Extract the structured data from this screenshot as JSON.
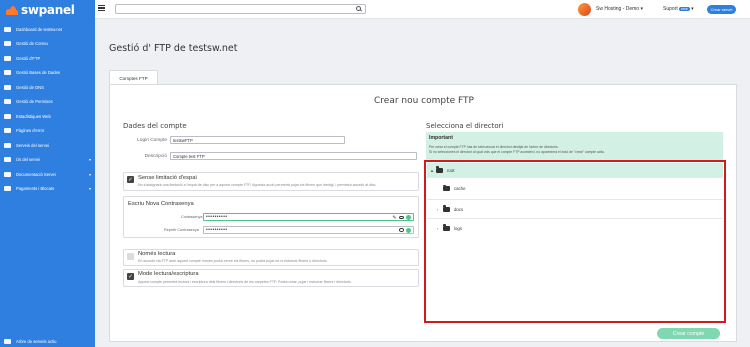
{
  "brand": {
    "name": "swpanel",
    "color": "#2f7fe0",
    "accent": "#ff7a2b"
  },
  "sidebar": {
    "items": [
      {
        "label": "Dashboard de testsw.net",
        "icon": "dashboard-icon"
      },
      {
        "label": "Gestió de Correu",
        "icon": "mail-icon"
      },
      {
        "label": "Gestió d'FTP",
        "icon": "ftp-icon"
      },
      {
        "label": "Gestió Bases de Dades",
        "icon": "database-icon"
      },
      {
        "label": "Gestió de DNS",
        "icon": "dns-icon"
      },
      {
        "label": "Gestió de Permisos",
        "icon": "flag-icon"
      },
      {
        "label": "Estadístiques Web",
        "icon": "pie-chart-icon"
      },
      {
        "label": "Pàgines d'error",
        "icon": "error-page-icon"
      },
      {
        "label": "Serveis del servei",
        "icon": "services-icon"
      },
      {
        "label": "Ús del servei",
        "icon": "usage-icon",
        "chevron": true
      },
      {
        "label": "Documentació Servei",
        "icon": "docs-icon",
        "chevron": true
      },
      {
        "label": "Pagaments i Blocats",
        "icon": "payments-icon",
        "chevron": true
      }
    ],
    "footer": "Arbre de serveis actiu"
  },
  "topbar": {
    "search_placeholder": "",
    "account": "Sw Hosting - Demo",
    "account_caret": "▾",
    "support": "Suport",
    "support_badge": "new",
    "support_caret": "▾",
    "create_server": "Crear servei"
  },
  "page": {
    "title": "Gestió d' FTP de testsw.net",
    "tab": "Comptes FTP"
  },
  "card": {
    "title": "Crear nou compte FTP",
    "account_section": {
      "title": "Dades del compte",
      "login_label": "Login Compte",
      "login_value": "testswFTP",
      "description_label": "Descripció",
      "description_value": "Compte test FTP"
    },
    "no_limit": {
      "title": "Sense limitació d'espai",
      "desc": "No s'assignarà una limitació a l'espai de disc per a aquest compte FTP. Aquesta acció permetrà pujar els fitxers que desitgi, i permetrà accedir al disc."
    },
    "password": {
      "title": "Escriu Nova Contrasenya",
      "pw_label": "Contrasenya",
      "pw_value": "••••••••••",
      "repeat_label": "Repetir Contrasenya",
      "repeat_value": "••••••••••"
    },
    "read_only": {
      "title": "Només lectura",
      "desc": "En accedir via FTP amb aquest compte només podrà veure els fitxers, no podrà pujar-ne ni esborrar fitxers o directoris."
    },
    "read_write": {
      "title": "Mode lectura/escriptura",
      "desc": "Aquest compte permetrà lectura i escriptura dels fitxers i directoris de les carpetes FTP. Podrà crear, pujar i esborrar fitxers i directoris."
    },
    "directory": {
      "title": "Selecciona el directori",
      "important_title": "Important",
      "important_line1": "Per crear el compte FTP has de seleccionar el directori desitjat de l'arbre de directoris.",
      "important_line2": "Si no selecciones el directori al qual vols que el compte FTP accedeixi, no apareixerà el botó de \"crear\" compte actiu.",
      "tree": [
        {
          "name": "root",
          "caret": "▲",
          "selected": true,
          "level": 0
        },
        {
          "name": "cache",
          "caret": "",
          "selected": false,
          "level": 1
        },
        {
          "name": "docs",
          "caret": "›",
          "selected": false,
          "level": 1
        },
        {
          "name": "logs",
          "caret": "›",
          "selected": false,
          "level": 1
        }
      ]
    },
    "create_button": "Crear compte"
  }
}
